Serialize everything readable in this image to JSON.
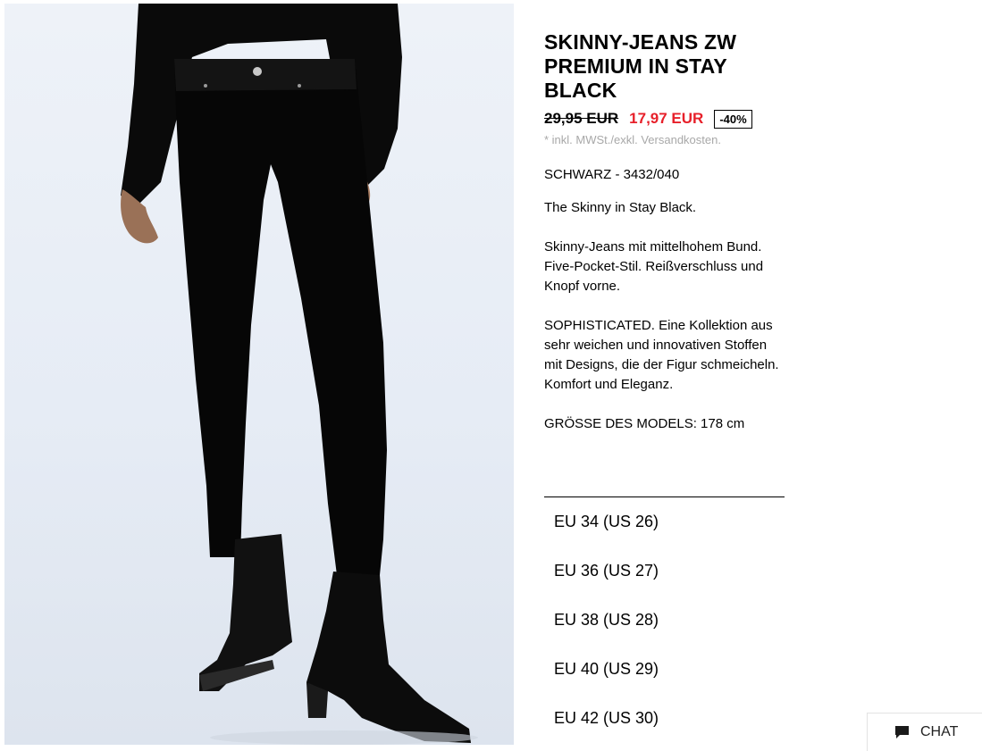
{
  "product": {
    "title": "SKINNY-JEANS ZW PREMIUM IN STAY BLACK",
    "old_price": "29,95 EUR",
    "new_price": "17,97 EUR",
    "discount": "-40%",
    "tax_note": "* inkl. MWSt./exkl. Versandkosten.",
    "color_ref": "SCHWARZ - 3432/040",
    "description": [
      "The Skinny in Stay Black.",
      "Skinny-Jeans mit mittelhohem Bund. Five-Pocket-Stil. Reißverschluss und Knopf vorne.",
      "SOPHISTICATED. Eine Kollektion aus sehr weichen und innovativen Stoffen mit Designs, die der Figur schmeicheln. Komfort und Eleganz.",
      "GRÖSSE DES MODELS: 178 cm"
    ],
    "image_icon": "product-photo-jeans"
  },
  "sizes": [
    "EU 34 (US 26)",
    "EU 36 (US 27)",
    "EU 38 (US 28)",
    "EU 40 (US 29)",
    "EU 42 (US 30)"
  ],
  "chat": {
    "label": "CHAT",
    "icon": "chat-bubble-icon"
  },
  "colors": {
    "sale_red": "#e7202a",
    "text": "#000000",
    "muted": "#a8a8a8",
    "image_background": "#e8edf5"
  }
}
